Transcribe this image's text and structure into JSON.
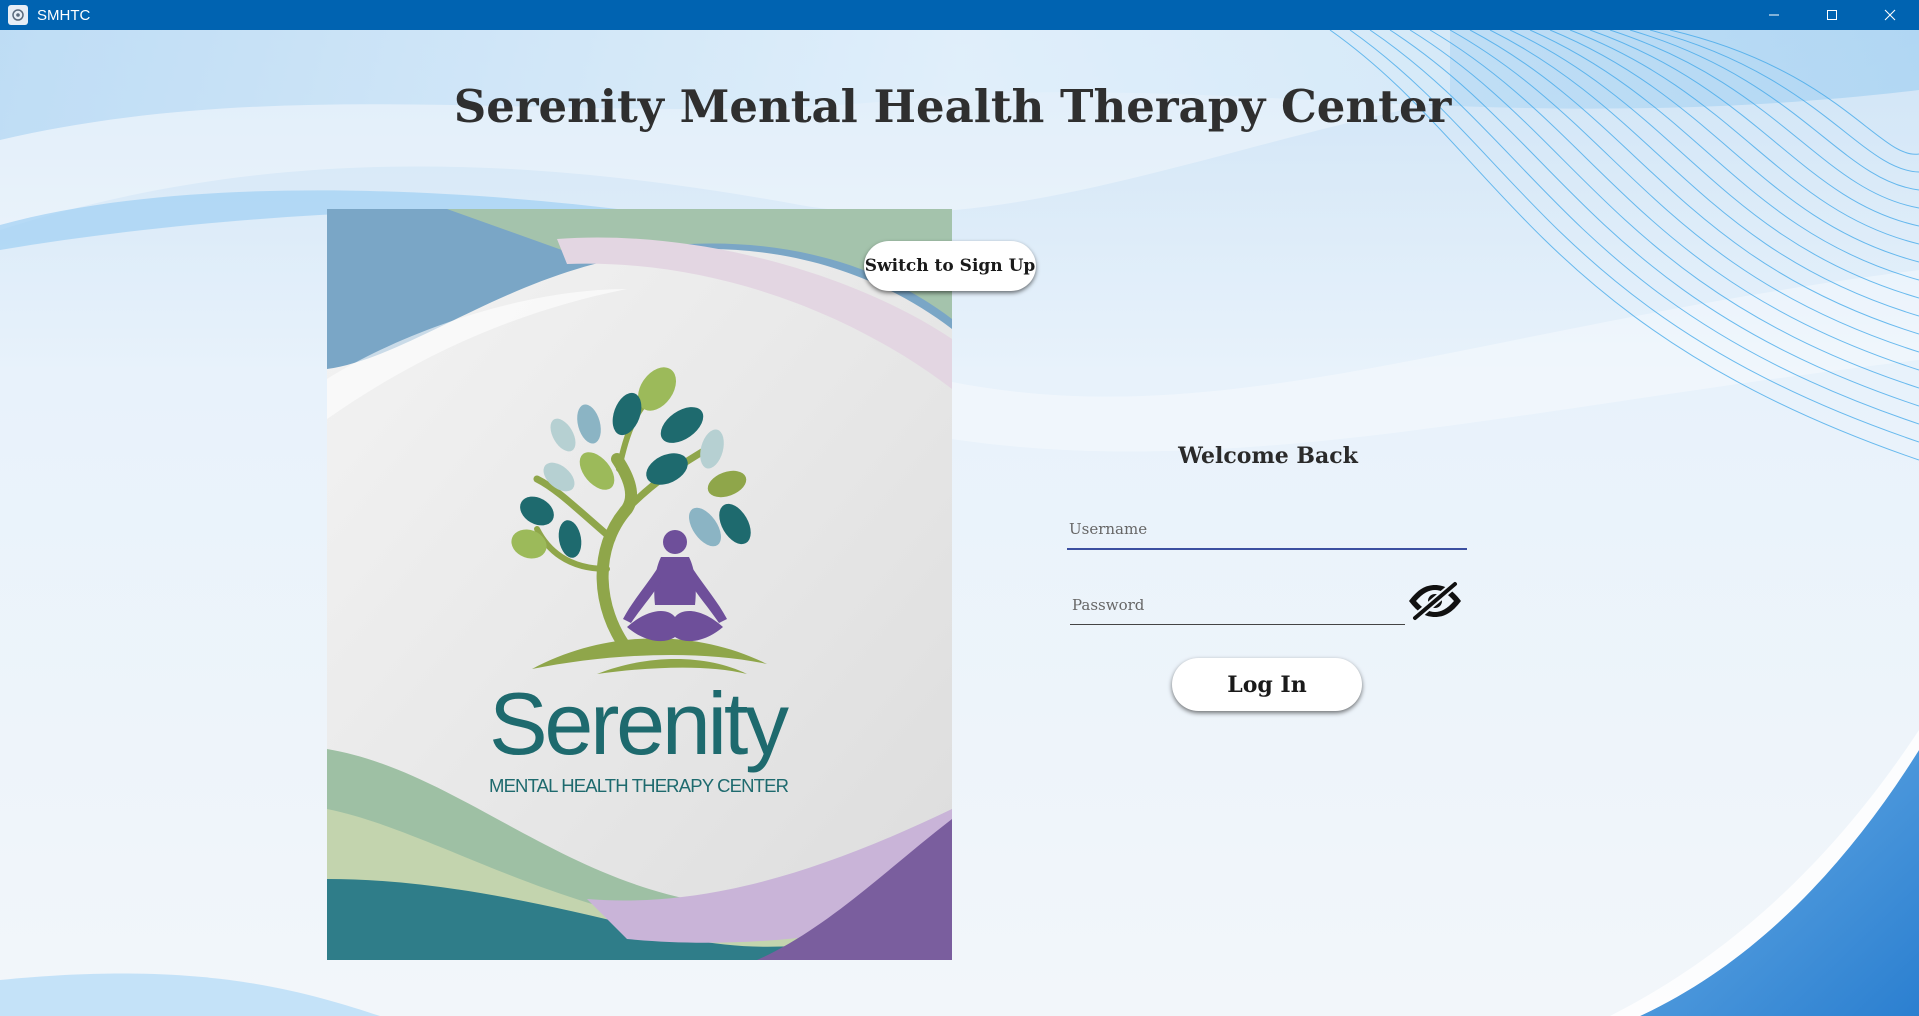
{
  "window": {
    "title": "SMHTC",
    "minimize_icon": "minimize-icon",
    "maximize_icon": "maximize-icon",
    "close_icon": "close-icon"
  },
  "header": {
    "title": "Serenity Mental Health Therapy Center"
  },
  "logo": {
    "wordmark": "Serenity",
    "tagline": "MENTAL HEALTH THERAPY CENTER"
  },
  "actions": {
    "switch_label": "Switch to Sign Up"
  },
  "login": {
    "heading": "Welcome Back",
    "username_placeholder": "Username",
    "password_placeholder": "Password",
    "password_toggle_icon": "eye-slash-icon",
    "submit_label": "Log In"
  },
  "colors": {
    "titlebar": "#0063b1",
    "accent": "#3c4fa0",
    "logo_teal": "#1e6a6e",
    "logo_purple": "#6e4f9a",
    "logo_olive": "#8fa64a"
  }
}
